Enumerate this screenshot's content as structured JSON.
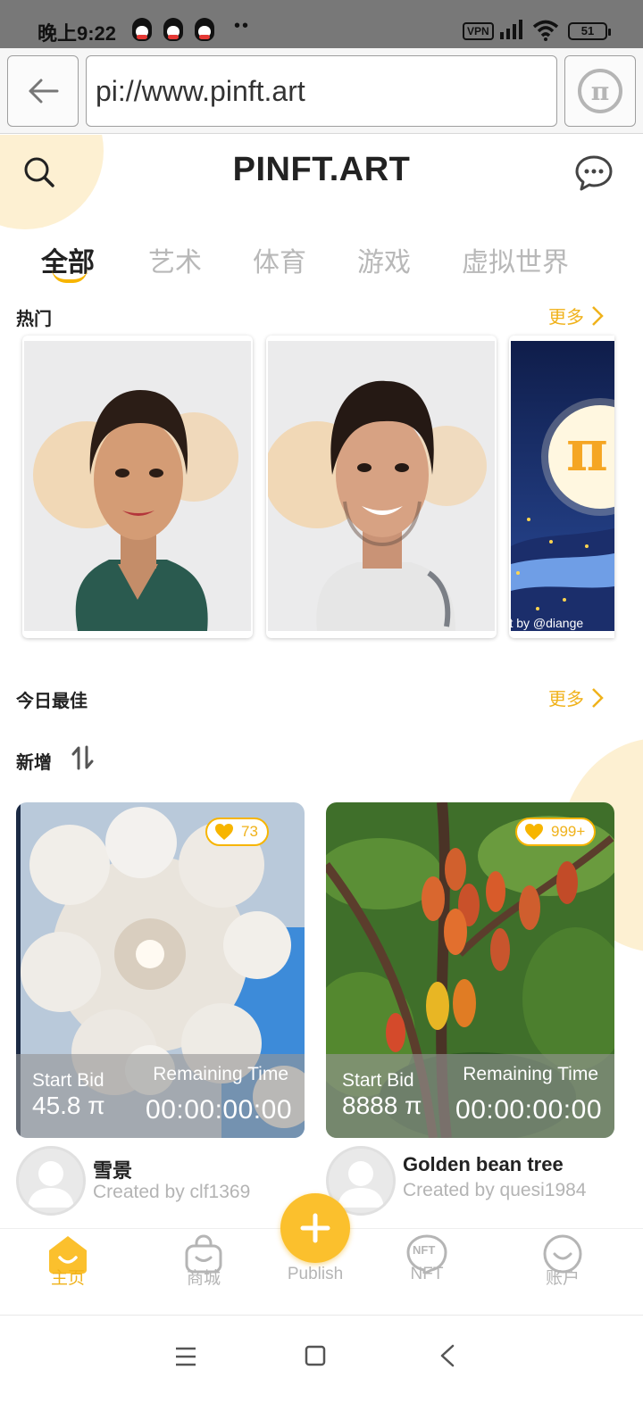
{
  "status_bar": {
    "time": "晚上9:22",
    "dots": "••",
    "vpn": "VPN",
    "battery": "51"
  },
  "browser": {
    "url": "pi://www.pinft.art",
    "pi_symbol": "π"
  },
  "header": {
    "title": "PINFT.ART"
  },
  "tabs": [
    {
      "label": "全部",
      "active": true
    },
    {
      "label": "艺术"
    },
    {
      "label": "体育"
    },
    {
      "label": "游戏"
    },
    {
      "label": "虚拟世界"
    }
  ],
  "sections": {
    "hot": {
      "label": "热门",
      "more": "更多"
    },
    "best_today": {
      "label": "今日最佳",
      "more": "更多"
    },
    "new": {
      "label": "新增"
    }
  },
  "hot_cards": [
    {
      "kind": "portrait-woman"
    },
    {
      "kind": "portrait-man"
    },
    {
      "kind": "pi-night",
      "caption": "art by @diange",
      "symbol": "π"
    }
  ],
  "new_items": [
    {
      "likes": "73",
      "start_bid_label": "Start Bid",
      "start_bid": "45.8 π",
      "remaining_label": "Remaining Time",
      "remaining": "00:00:00:00",
      "name": "雪景",
      "creator": "Created by clf1369"
    },
    {
      "likes": "999+",
      "start_bid_label": "Start Bid",
      "start_bid": "8888 π",
      "remaining_label": "Remaining Time",
      "remaining": "00:00:00:00",
      "name": "Golden bean tree",
      "creator": "Created by quesi1984"
    }
  ],
  "bottom_nav": [
    {
      "label": "主页",
      "icon": "home-icon",
      "active": true
    },
    {
      "label": "商城",
      "icon": "shopping-bag-icon"
    },
    {
      "label": "Publish",
      "icon": "plus-icon"
    },
    {
      "label": "NFT",
      "icon": "nft-icon",
      "badge": "NFT"
    },
    {
      "label": "账户",
      "icon": "account-icon"
    }
  ],
  "colors": {
    "accent": "#F7B500",
    "accent_text": "#F0B21B",
    "muted": "#B5B5B5",
    "blob": "#FDF0D2"
  }
}
